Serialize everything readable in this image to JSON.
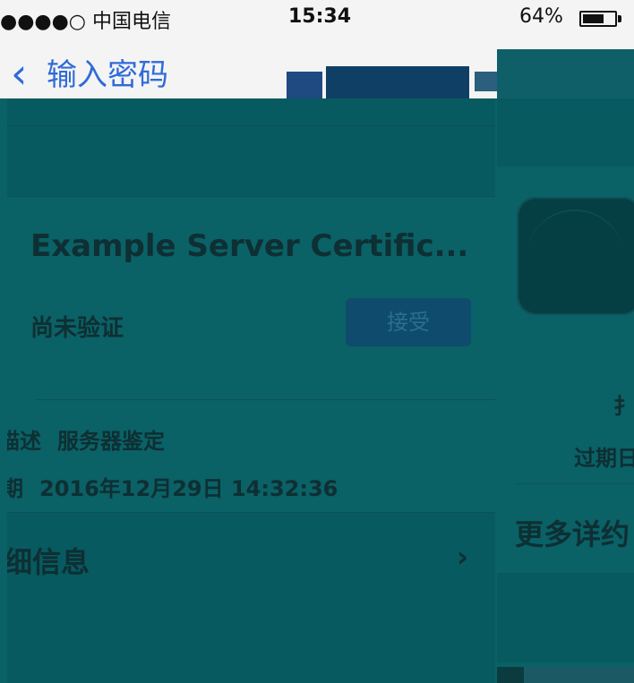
{
  "status_bar": {
    "carrier": "●●●●○ 中国电信",
    "time": "15:34",
    "battery": "64%"
  },
  "nav": {
    "back_label": "输入密码",
    "chevron": "‹"
  },
  "certificate": {
    "title": "Example Server Certific...",
    "status": "尚未验证",
    "accept_label": "接受",
    "rows": [
      {
        "label": "描述",
        "value": "服务器鉴定"
      },
      {
        "label": "期",
        "value": "2016年12月29日 14:32:36"
      }
    ],
    "details_label": "细信息",
    "details_chevron": "›"
  },
  "right_panel": {
    "text1": "扌",
    "text2": "过期日",
    "more": "更多详约"
  },
  "colors": {
    "background": "#0a6166",
    "status_bar": "#f4f4f4",
    "accent": "#2f6bd8",
    "accept_button": "#0f4b6c",
    "text": "#0e2f33"
  },
  "icons": [
    "back-chevron-icon",
    "battery-icon",
    "certificate-app-icon",
    "chevron-right-icon"
  ]
}
